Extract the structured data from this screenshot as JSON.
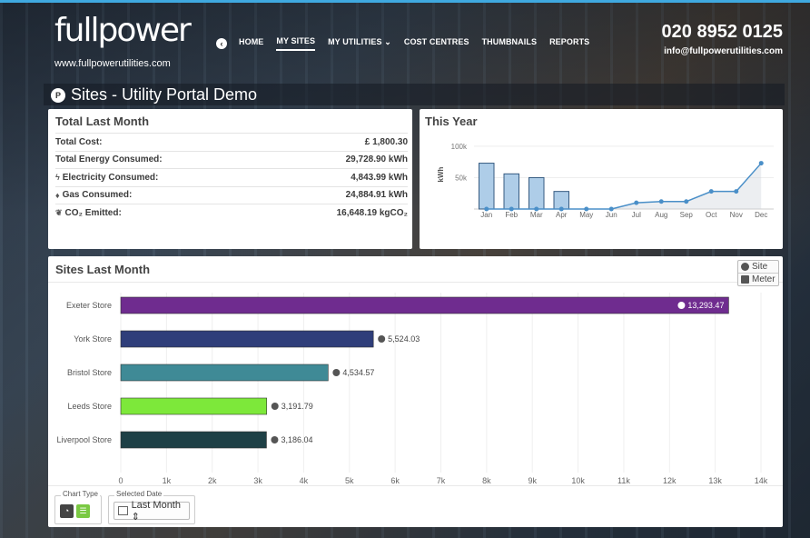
{
  "header": {
    "logo_text": "fullpower",
    "url": "www.fullpowerutilities.com",
    "phone": "020 8952 0125",
    "email": "info@fullpowerutilities.com",
    "nav": [
      {
        "label": "HOME",
        "active": false
      },
      {
        "label": "MY SITES",
        "active": true
      },
      {
        "label": "MY UTILITIES ⌄",
        "active": false
      },
      {
        "label": "COST CENTRES",
        "active": false
      },
      {
        "label": "THUMBNAILS",
        "active": false
      },
      {
        "label": "REPORTS",
        "active": false
      }
    ]
  },
  "page_title": "Sites - Utility Portal Demo",
  "total_last_month": {
    "title": "Total Last Month",
    "rows": [
      {
        "label": "Total Cost:",
        "icon": "",
        "value": "£ 1,800.30"
      },
      {
        "label": "Total Energy Consumed:",
        "icon": "",
        "value": "29,728.90 kWh"
      },
      {
        "label": "Electricity Consumed:",
        "icon": "lightning-icon",
        "value": "4,843.99 kWh"
      },
      {
        "label": "Gas Consumed:",
        "icon": "flame-icon",
        "value": "24,884.91 kWh"
      },
      {
        "label": "CO₂ Emitted:",
        "icon": "footprint-icon",
        "value": "16,648.19 kgCO₂"
      }
    ]
  },
  "this_year": {
    "title": "This Year"
  },
  "sites_last_month": {
    "title": "Sites Last Month",
    "toggle": {
      "site_label": "Site",
      "meter_label": "Meter"
    },
    "chart_type_label": "Chart Type",
    "selected_date_label": "Selected Date",
    "selected_date_value": "Last Month ⇕"
  },
  "chart_data": [
    {
      "type": "bar",
      "title": "This Year",
      "ylabel": "kWh",
      "categories": [
        "Jan",
        "Feb",
        "Mar",
        "Apr",
        "May",
        "Jun",
        "Jul",
        "Aug",
        "Sep",
        "Oct",
        "Nov",
        "Dec"
      ],
      "yticks": [
        "50k",
        "100k"
      ],
      "ylim": [
        0,
        110000
      ],
      "series": [
        {
          "kind": "bar",
          "color": "#aecde8",
          "values": [
            73000,
            56000,
            50000,
            28000,
            0,
            0,
            0,
            0,
            0,
            0,
            0,
            0
          ]
        },
        {
          "kind": "line",
          "color": "#4a8fc8",
          "values": [
            0,
            0,
            0,
            0,
            0,
            0,
            10000,
            12000,
            12000,
            28000,
            28000,
            73000
          ]
        }
      ]
    },
    {
      "type": "bar",
      "orientation": "horizontal",
      "title": "Sites Last Month",
      "categories": [
        "Exeter Store",
        "York Store",
        "Bristol Store",
        "Leeds Store",
        "Liverpool Store"
      ],
      "values": [
        13293.47,
        5524.03,
        4534.57,
        3191.79,
        3186.04
      ],
      "labels": [
        "13,293.47",
        "5,524.03",
        "4,534.57",
        "3,191.79",
        "3,186.04"
      ],
      "colors": [
        "#6f2c8f",
        "#2f3e7a",
        "#3f8a96",
        "#7de83a",
        "#1e4046"
      ],
      "xticks": [
        "0",
        "1k",
        "2k",
        "3k",
        "4k",
        "5k",
        "6k",
        "7k",
        "8k",
        "9k",
        "10k",
        "11k",
        "12k",
        "13k",
        "14k"
      ],
      "xlim": [
        0,
        14000
      ]
    }
  ]
}
